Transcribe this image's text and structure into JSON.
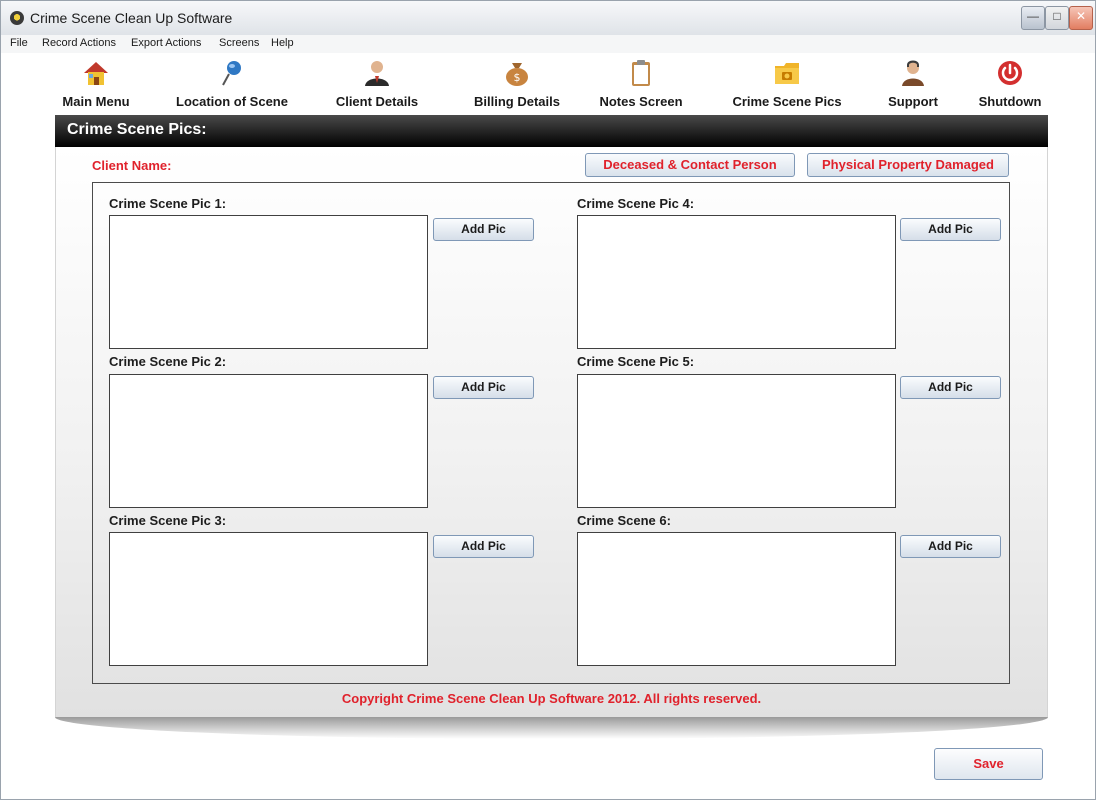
{
  "window": {
    "title": "Crime Scene Clean Up Software"
  },
  "menu": {
    "items": [
      "File",
      "Record Actions",
      "Export Actions",
      "Screens",
      "Help"
    ]
  },
  "toolbar": {
    "items": [
      {
        "label": "Main Menu",
        "icon": "house-icon"
      },
      {
        "label": "Location of Scene",
        "icon": "pushpin-icon"
      },
      {
        "label": "Client Details",
        "icon": "person-icon"
      },
      {
        "label": "Billing Details",
        "icon": "money-bag-icon"
      },
      {
        "label": "Notes Screen",
        "icon": "clipboard-icon"
      },
      {
        "label": "Crime Scene Pics",
        "icon": "photo-folder-icon"
      },
      {
        "label": "Support",
        "icon": "support-agent-icon"
      },
      {
        "label": "Shutdown",
        "icon": "power-icon"
      }
    ]
  },
  "header": {
    "title": "Crime Scene Pics:"
  },
  "client": {
    "label": "Client Name:"
  },
  "buttons": {
    "deceased_contact": "Deceased & Contact Person",
    "physical_property": "Physical Property Damaged",
    "save": "Save"
  },
  "pics": [
    {
      "label": "Crime Scene Pic 1:",
      "button": "Add Pic"
    },
    {
      "label": "Crime Scene Pic 2:",
      "button": "Add Pic"
    },
    {
      "label": "Crime Scene Pic 3:",
      "button": "Add Pic"
    },
    {
      "label": "Crime Scene Pic 4:",
      "button": "Add Pic"
    },
    {
      "label": "Crime Scene Pic 5:",
      "button": "Add Pic"
    },
    {
      "label": "Crime Scene 6:",
      "button": "Add Pic"
    }
  ],
  "footer": {
    "copyright": "Copyright Crime Scene Clean Up Software 2012. All rights reserved."
  },
  "colors": {
    "accent_red": "#e0222c",
    "header_bar": "#000000",
    "button_border": "#7f98b6"
  }
}
